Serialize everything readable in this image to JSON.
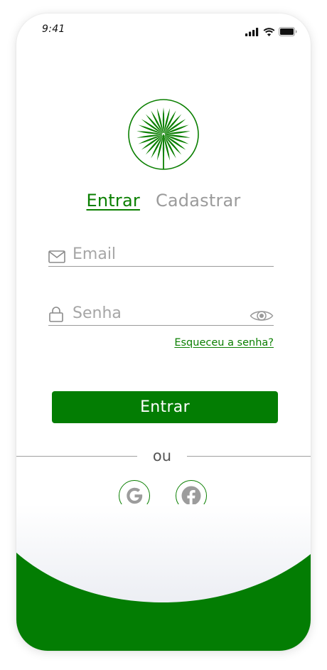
{
  "status_bar": {
    "time": "9:41",
    "icons": [
      "signal-icon",
      "wifi-icon",
      "battery-icon"
    ]
  },
  "logo": {
    "icon": "palm-leaf-icon"
  },
  "tabs": [
    {
      "label": "Entrar",
      "active": true
    },
    {
      "label": "Cadastrar",
      "active": false
    }
  ],
  "form": {
    "email": {
      "placeholder": "Email",
      "value": "",
      "icon": "mail-icon"
    },
    "password": {
      "placeholder": "Senha",
      "value": "",
      "icon": "lock-icon",
      "toggle_icon": "eye-icon"
    },
    "forgot_link": "Esqueceu a senha?",
    "submit_label": "Entrar"
  },
  "divider": {
    "text": "ou"
  },
  "social": [
    {
      "name": "google",
      "icon": "google-icon"
    },
    {
      "name": "facebook",
      "icon": "facebook-icon"
    }
  ],
  "colors": {
    "brand_green": "#037d03",
    "link_green": "#0a7f00",
    "inactive_gray": "#9b9b9b"
  }
}
